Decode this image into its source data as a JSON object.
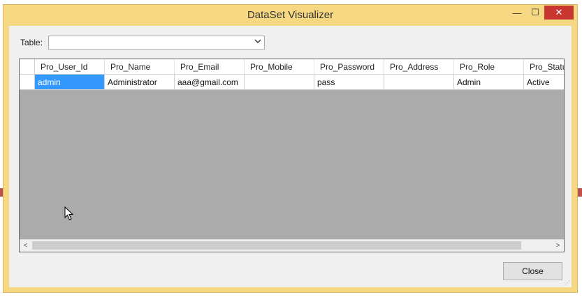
{
  "window": {
    "title": "DataSet Visualizer",
    "min_glyph": "—",
    "max_glyph": "☐",
    "close_glyph": "✕"
  },
  "table_picker": {
    "label": "Table:",
    "value": "",
    "arrow_icon": "chevron-down-icon"
  },
  "grid": {
    "columns": [
      "Pro_User_Id",
      "Pro_Name",
      "Pro_Email",
      "Pro_Mobile",
      "Pro_Password",
      "Pro_Address",
      "Pro_Role",
      "Pro_Statu"
    ],
    "rows": [
      [
        "admin",
        "Administrator",
        "aaa@gmail.com",
        "",
        "pass",
        "",
        "Admin",
        "Active"
      ]
    ],
    "selected_cell": "admin"
  },
  "scrollbar": {
    "left_glyph": "<",
    "right_glyph": ">"
  },
  "footer": {
    "close_label": "Close"
  },
  "colors": {
    "window_frame": "#f6d883",
    "close_button": "#c7372f",
    "selection": "#3399ff",
    "grid_background": "#ababab"
  }
}
